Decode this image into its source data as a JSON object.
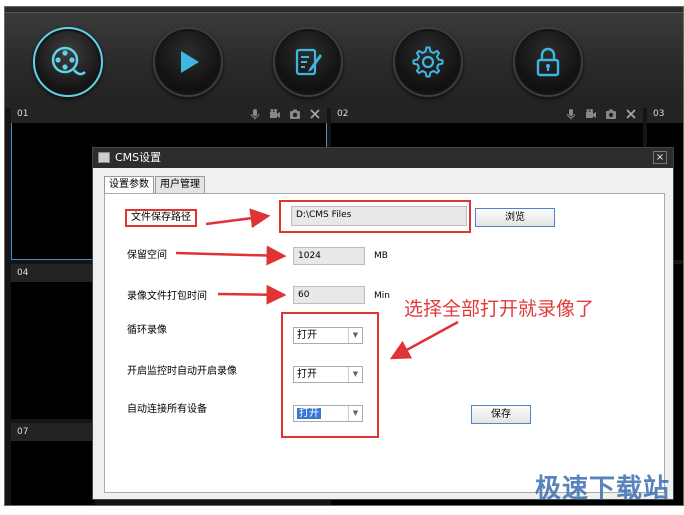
{
  "toolbar": {
    "buttons": [
      {
        "id": "playback-video",
        "icon": "film-reel-icon",
        "active": true
      },
      {
        "id": "play",
        "icon": "play-icon",
        "active": false
      },
      {
        "id": "edit",
        "icon": "edit-document-icon",
        "active": false
      },
      {
        "id": "settings",
        "icon": "gear-icon",
        "active": false
      },
      {
        "id": "lock",
        "icon": "lock-icon",
        "active": false
      }
    ],
    "accent_color": "#5ed4e6",
    "icon_color": "#3fb6e0"
  },
  "tiles": {
    "t01": "01",
    "t02": "02",
    "t03": "03",
    "t04": "04",
    "t07": "07"
  },
  "dialog": {
    "title": "CMS设置",
    "close": "×",
    "tabs": {
      "params": "设置参数",
      "users": "用户管理"
    },
    "file_path_label": "文件保存路径",
    "file_path_value": "D:\\CMS Files",
    "browse": "浏览",
    "reserve_label": "保留空间",
    "reserve_value": "1024",
    "reserve_unit": "MB",
    "pack_label": "录像文件打包时间",
    "pack_value": "60",
    "pack_unit": "Min",
    "loop_label": "循环录像",
    "loop_value": "打开",
    "auto_start_label": "开启监控时自动开启录像",
    "auto_start_value": "打开",
    "auto_connect_label": "自动连接所有设备",
    "auto_connect_value": "打开",
    "save": "保存"
  },
  "annotation": "选择全部打开就录像了",
  "watermark": "极速下载站"
}
